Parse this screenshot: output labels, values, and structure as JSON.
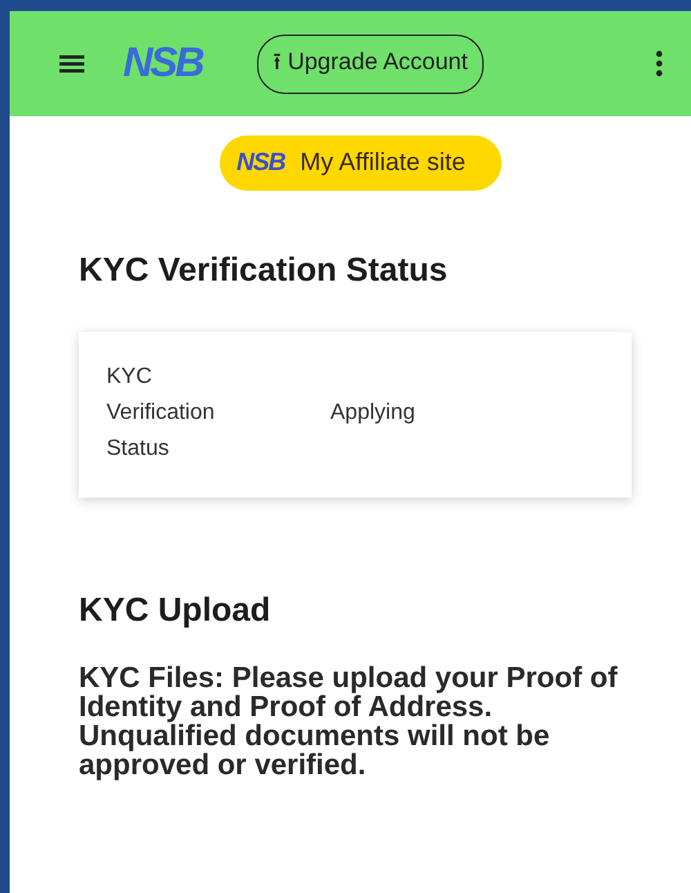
{
  "header": {
    "logo": "NSB",
    "upgrade_button": {
      "icon": "⭱",
      "label": "Upgrade Account"
    }
  },
  "affiliate_button": {
    "logo": "NSB",
    "label": "My Affiliate site"
  },
  "verification": {
    "title": "KYC Verification Status",
    "rows": [
      {
        "label": "KYC Verification Status",
        "value": "Applying"
      }
    ]
  },
  "upload": {
    "title": "KYC Upload",
    "notes": [
      "KYC Files: Please upload your Proof of Identity and Proof of Address.",
      "Unqualified documents will not be approved or verified."
    ]
  }
}
